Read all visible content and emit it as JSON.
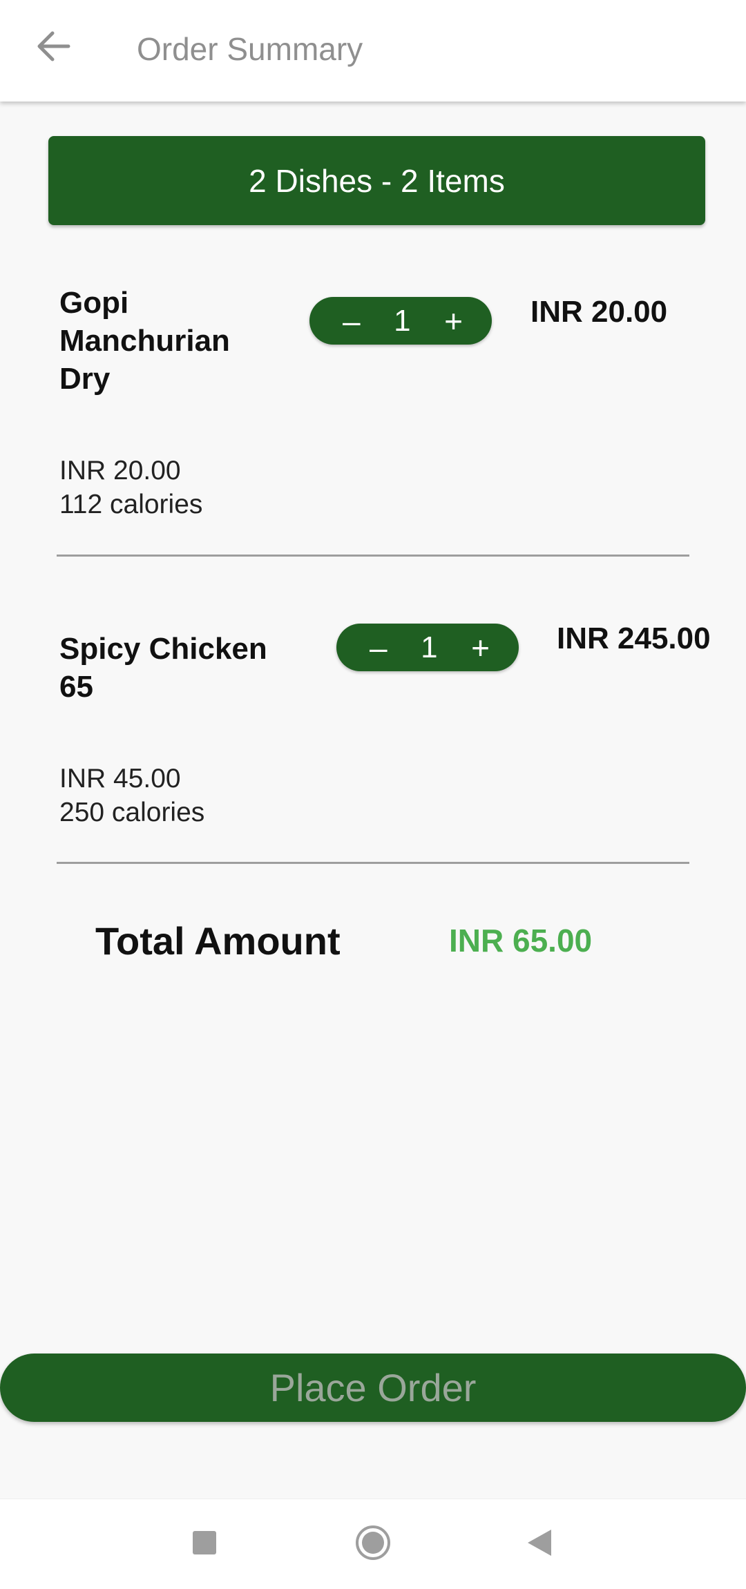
{
  "appbar": {
    "title": "Order Summary",
    "back_icon": "arrow-left-icon"
  },
  "summary": {
    "text": "2 Dishes - 2 Items"
  },
  "items": [
    {
      "name_lines": [
        "Gopi",
        "Manchurian",
        "Dry"
      ],
      "quantity": "1",
      "minus": "–",
      "plus": "+",
      "total": "INR 20.00",
      "unit_price": "INR 20.00",
      "calories": "112 calories"
    },
    {
      "name_lines": [
        "Spicy Chicken",
        "65"
      ],
      "quantity": "1",
      "minus": "–",
      "plus": "+",
      "total": "INR 245.00",
      "unit_price": "INR 45.00",
      "calories": "250 calories"
    }
  ],
  "total": {
    "label": "Total Amount",
    "value": "INR 65.00"
  },
  "place_order": {
    "label": "Place Order"
  },
  "system_nav": {
    "icons": [
      "square-recents-icon",
      "circle-home-icon",
      "triangle-back-icon"
    ]
  },
  "colors": {
    "primary_green": "#1f5f22",
    "total_green": "#4caf50",
    "title_gray": "#8f8f8f"
  }
}
